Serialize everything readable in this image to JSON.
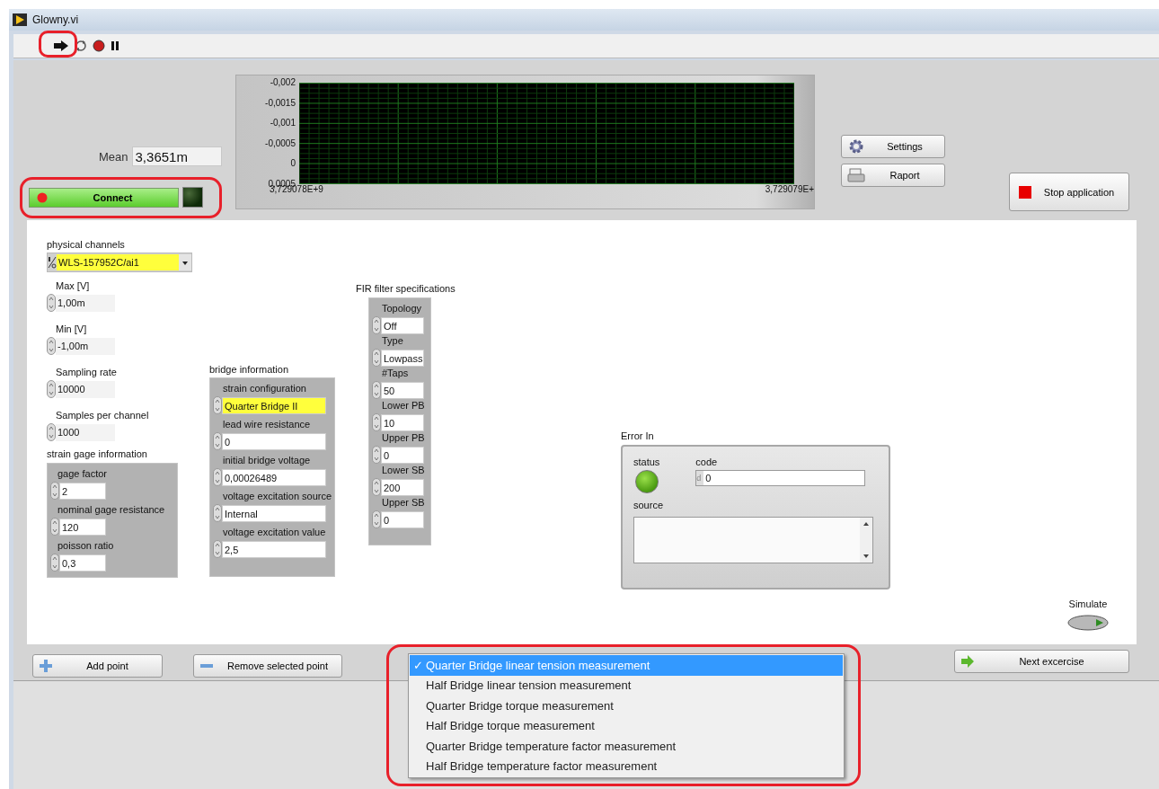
{
  "window": {
    "title": "Glowny.vi"
  },
  "toolbar": {
    "highlighted": true
  },
  "mean": {
    "label": "Mean",
    "value": "3,3651m"
  },
  "connect": {
    "label": "Connect",
    "led_on": false,
    "highlighted": true
  },
  "chart": {
    "yticks": [
      "-0,002",
      "-0,0015",
      "-0,001",
      "-0,0005",
      "0",
      "0,0005"
    ],
    "xticks": [
      "3,729078E+9",
      "3,729079E+"
    ]
  },
  "side_buttons": [
    {
      "kind": "settings",
      "label": "Settings"
    },
    {
      "kind": "report",
      "label": "Raport"
    }
  ],
  "stop_button": {
    "label": "Stop application"
  },
  "physical_channels": {
    "label": "physical channels",
    "value": "WLS-157952C/ai1",
    "highlighted": true
  },
  "numerics": [
    {
      "label": "Max [V]",
      "value": "1,00m"
    },
    {
      "label": "Min [V]",
      "value": "-1,00m"
    },
    {
      "label": "Sampling rate",
      "value": "10000"
    },
    {
      "label": "Samples per channel",
      "value": "1000"
    }
  ],
  "strain_gage": {
    "label": "strain gage information",
    "fields": [
      {
        "label": "gage factor",
        "value": "2",
        "highlighted": false
      },
      {
        "label": "nominal gage resistance",
        "value": "120",
        "highlighted": false
      },
      {
        "label": "poisson ratio",
        "value": "0,3",
        "highlighted": false
      }
    ]
  },
  "bridge": {
    "label": "bridge information",
    "fields": [
      {
        "label": "strain configuration",
        "value": "Quarter Bridge II",
        "highlighted": true
      },
      {
        "label": "lead wire resistance",
        "value": "0",
        "highlighted": false
      },
      {
        "label": "initial bridge voltage",
        "value": "0,00026489",
        "highlighted": false
      },
      {
        "label": "voltage excitation source",
        "value": "Internal",
        "highlighted": false
      },
      {
        "label": "voltage excitation value",
        "value": "2,5",
        "highlighted": false
      }
    ]
  },
  "fir": {
    "label": "FIR filter specifications",
    "fields": [
      {
        "label": "Topology",
        "value": "Off",
        "highlighted": false
      },
      {
        "label": "Type",
        "value": "Lowpass",
        "highlighted": false
      },
      {
        "label": "#Taps",
        "value": "50",
        "highlighted": false
      },
      {
        "label": "Lower PB",
        "value": "10",
        "highlighted": false
      },
      {
        "label": "Upper PB",
        "value": "0",
        "highlighted": false
      },
      {
        "label": "Lower SB",
        "value": "200",
        "highlighted": false
      },
      {
        "label": "Upper SB",
        "value": "0",
        "highlighted": false
      }
    ]
  },
  "error_in": {
    "label": "Error In",
    "status_label": "status",
    "status_ok": true,
    "code_label": "code",
    "code_prefix": "d",
    "code": "0",
    "source_label": "source"
  },
  "simulate": {
    "label": "Simulate",
    "on": false
  },
  "bottom_buttons": [
    {
      "kind": "add",
      "label": "Add point"
    },
    {
      "kind": "remove",
      "label": "Remove selected point"
    },
    {
      "kind": "next",
      "label": "Next excercise"
    }
  ],
  "menu": {
    "highlighted": true,
    "check_mark": "✓",
    "items": [
      {
        "label": "Quarter Bridge linear tension measurement",
        "selected": true
      },
      {
        "label": "Half Bridge linear tension measurement",
        "selected": false
      },
      {
        "label": "Quarter Bridge torque measurement",
        "selected": false
      },
      {
        "label": "Half Bridge torque measurement",
        "selected": false
      },
      {
        "label": "Quarter Bridge temperature factor measurement",
        "selected": false
      },
      {
        "label": "Half Bridge temperature factor measurement",
        "selected": false
      }
    ]
  }
}
